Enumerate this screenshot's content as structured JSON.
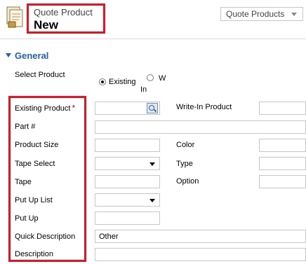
{
  "header": {
    "entity_type": "Quote Product",
    "record_name": "New",
    "form_selector": "Quote Products"
  },
  "section": {
    "title": "General"
  },
  "select_product": {
    "label": "Select Product",
    "option_existing": "Existing",
    "option_writein_lines": [
      "W",
      "In"
    ]
  },
  "fields": {
    "existing_product": "Existing Product",
    "write_in_product": "Write-In Product",
    "part_number": "Part #",
    "product_size": "Product Size",
    "color": "Color",
    "tape_select": "Tape Select",
    "type": "Type",
    "tape": "Tape",
    "option": "Option",
    "put_up_list": "Put Up List",
    "put_up": "Put Up",
    "quick_description": "Quick Description",
    "quick_description_value": "Other",
    "description": "Description"
  }
}
